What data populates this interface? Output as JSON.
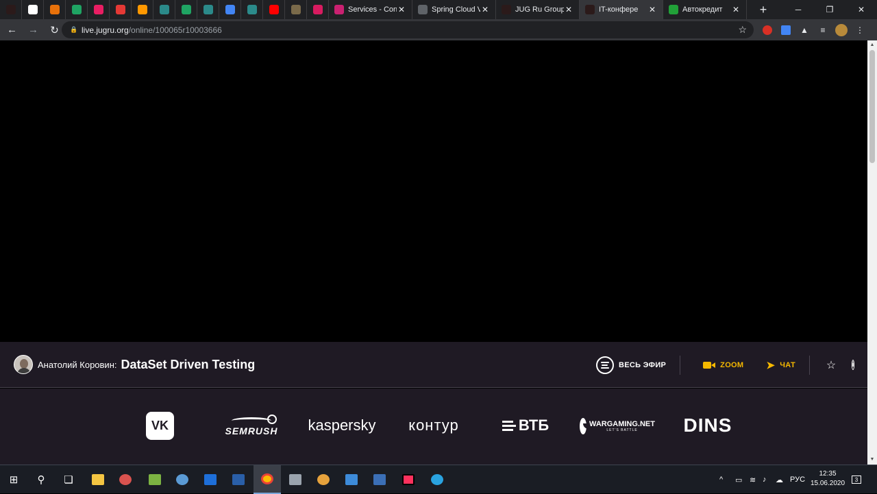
{
  "browser": {
    "pinned_tabs": [
      {
        "icon": "dark-app-icon",
        "color": "#2b1a1a"
      },
      {
        "icon": "google-icon",
        "color": "#ffffff"
      },
      {
        "icon": "orange-diamond-icon",
        "color": "#e8710a"
      },
      {
        "icon": "green-hexagon-icon",
        "color": "#1fa463"
      },
      {
        "icon": "pink-play-icon",
        "color": "#e91e63"
      },
      {
        "icon": "red-play-icon",
        "color": "#e53935"
      },
      {
        "icon": "orange-circle-icon",
        "color": "#ff9800"
      },
      {
        "icon": "teal-snowflake-icon",
        "color": "#2b8a8a"
      },
      {
        "icon": "green-hexagon-icon",
        "color": "#1fa463"
      },
      {
        "icon": "teal-snowflake-icon",
        "color": "#2b8a8a"
      },
      {
        "icon": "google-docs-icon",
        "color": "#4285f4"
      },
      {
        "icon": "teal-snowflake-icon",
        "color": "#2b8a8a"
      },
      {
        "icon": "youtube-icon",
        "color": "#ff0000"
      },
      {
        "icon": "robot-icon",
        "color": "#7a6a4a"
      },
      {
        "icon": "pink-square-icon",
        "color": "#d81b60"
      }
    ],
    "tabs": [
      {
        "title": "Services - Cons",
        "icon": "consul-icon",
        "color": "#ca2171",
        "active": false
      },
      {
        "title": "Spring Cloud V",
        "icon": "globe-icon",
        "color": "#5f6368",
        "active": false
      },
      {
        "title": "JUG Ru Group:",
        "icon": "jug-icon",
        "color": "#2b1a1a",
        "active": false
      },
      {
        "title": "IT-конфере",
        "icon": "jug-icon",
        "color": "#2b1a1a",
        "active": true
      },
      {
        "title": "Автокредит",
        "icon": "bank-icon",
        "color": "#21a038",
        "active": false
      }
    ],
    "new_tab": "+",
    "close_glyph": "✕",
    "address": {
      "host": "live.jugru.org",
      "path": "/online/100065r10003666"
    }
  },
  "player": {
    "speaker": "Анатолий Коровин:",
    "talk_title": "DataSet Driven Testing",
    "all_broadcast": "ВЕСЬ ЭФИР",
    "zoom": "ZOOM",
    "chat": "ЧАТ",
    "accent_color": "#f5b800"
  },
  "sponsors": {
    "vk": "VK",
    "semrush": "SEMRUSH",
    "kaspersky": "kaspersky",
    "kontur": "контур",
    "vtb": "ВТБ",
    "wargaming": "WARGAMING.NET",
    "wargaming_tag": "LET'S BATTLE",
    "dins": "DINS"
  },
  "taskbar": {
    "language": "РУС",
    "time": "12:35",
    "date": "15.06.2020",
    "notifications": "3"
  }
}
